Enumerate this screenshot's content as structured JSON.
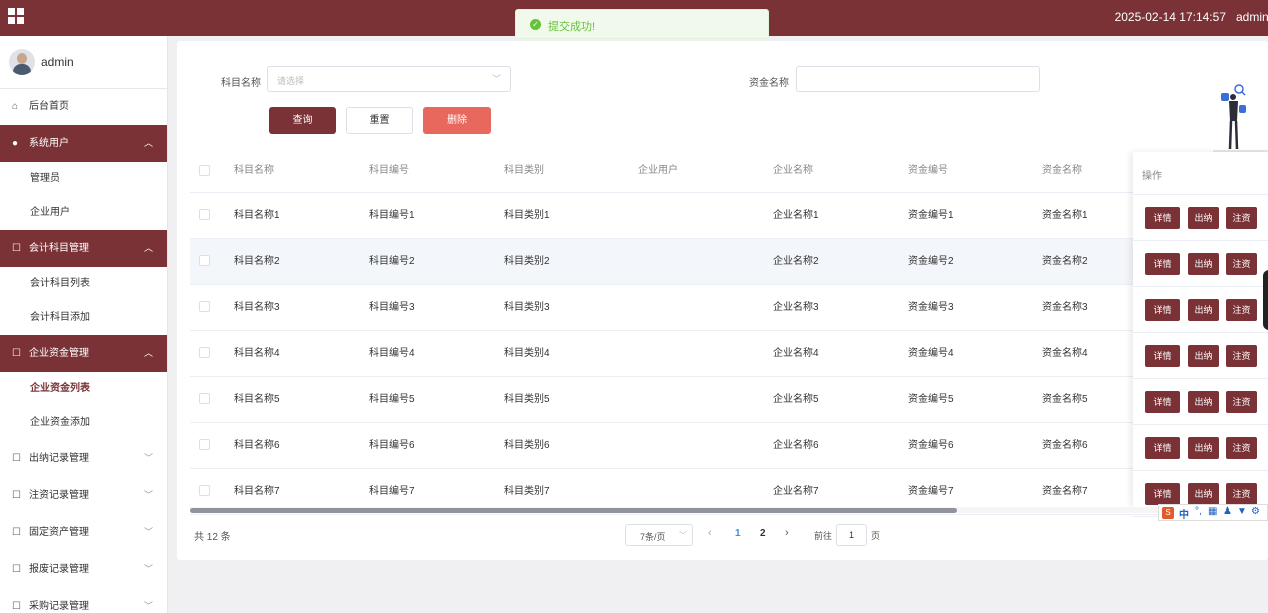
{
  "header": {
    "datetime": "2025-02-14 17:14:57",
    "user": "admin"
  },
  "toast": {
    "message": "提交成功!"
  },
  "sidebar": {
    "username": "admin",
    "home": "后台首页",
    "groups": [
      {
        "label": "系统用户",
        "children": [
          "管理员",
          "企业用户"
        ]
      },
      {
        "label": "会计科目管理",
        "children": [
          "会计科目列表",
          "会计科目添加"
        ]
      },
      {
        "label": "企业资金管理",
        "children": [
          "企业资金列表",
          "企业资金添加"
        ]
      }
    ],
    "collapsed": [
      "出纳记录管理",
      "注资记录管理",
      "固定资产管理",
      "报废记录管理",
      "采购记录管理"
    ]
  },
  "filters": {
    "subject_label": "科目名称",
    "subject_placeholder": "请选择",
    "fund_label": "资金名称",
    "query": "查询",
    "reset": "重置",
    "delete": "删除"
  },
  "table": {
    "columns": [
      "科目名称",
      "科目编号",
      "科目类别",
      "企业用户",
      "企业名称",
      "资金编号",
      "资金名称",
      "操作"
    ],
    "rows": [
      [
        "科目名称1",
        "科目编号1",
        "科目类别1",
        "",
        "企业名称1",
        "资金编号1",
        "资金名称1"
      ],
      [
        "科目名称2",
        "科目编号2",
        "科目类别2",
        "",
        "企业名称2",
        "资金编号2",
        "资金名称2"
      ],
      [
        "科目名称3",
        "科目编号3",
        "科目类别3",
        "",
        "企业名称3",
        "资金编号3",
        "资金名称3"
      ],
      [
        "科目名称4",
        "科目编号4",
        "科目类别4",
        "",
        "企业名称4",
        "资金编号4",
        "资金名称4"
      ],
      [
        "科目名称5",
        "科目编号5",
        "科目类别5",
        "",
        "企业名称5",
        "资金编号5",
        "资金名称5"
      ],
      [
        "科目名称6",
        "科目编号6",
        "科目类别6",
        "",
        "企业名称6",
        "资金编号6",
        "资金名称6"
      ],
      [
        "科目名称7",
        "科目编号7",
        "科目类别7",
        "",
        "企业名称7",
        "资金编号7",
        "资金名称7"
      ]
    ],
    "actions": [
      "详情",
      "出纳",
      "注资"
    ]
  },
  "pagination": {
    "total": "共 12 条",
    "page_size": "7条/页",
    "pages": [
      "1",
      "2"
    ],
    "goto_label": "前往",
    "goto_value": "1",
    "page_suffix": "页"
  },
  "ime": {
    "lang": "中"
  }
}
